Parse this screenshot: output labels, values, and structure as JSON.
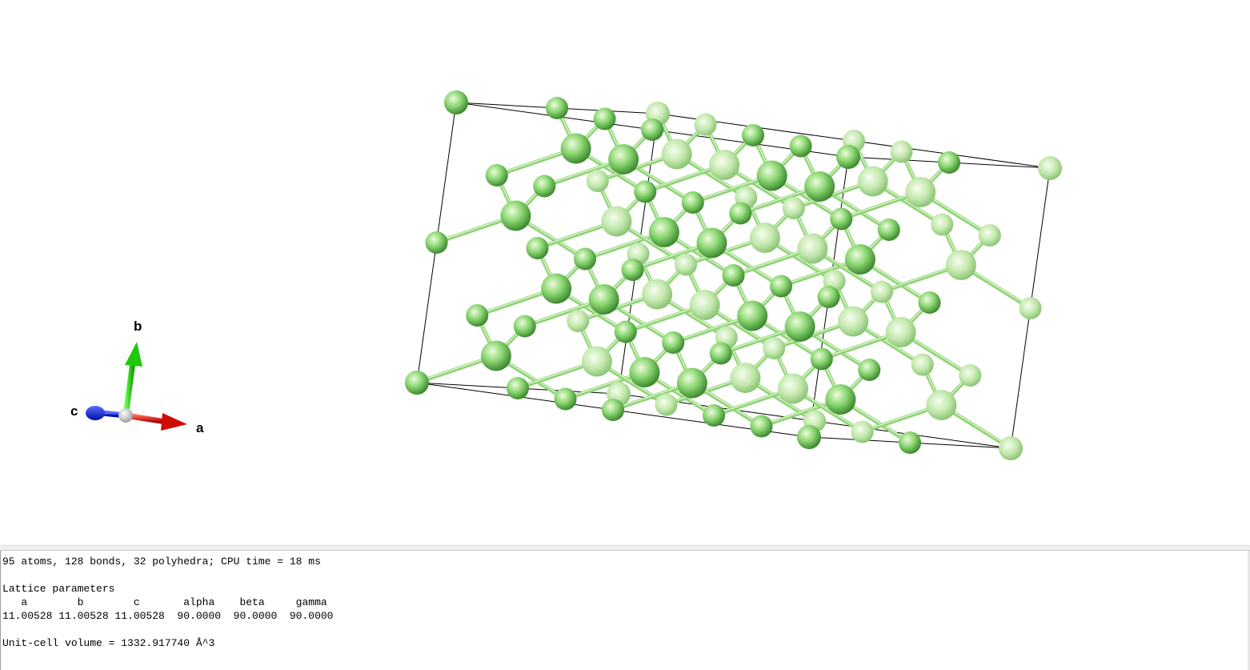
{
  "axes": {
    "a_label": "a",
    "b_label": "b",
    "c_label": "c"
  },
  "structure": {
    "atom_color_bright": "#e8f7d4",
    "atom_color_mid": "#84d06a",
    "atom_color_dark": "#2f7d24",
    "bond_color": "#8fd476",
    "cell_edge_color": "#000000"
  },
  "output": {
    "lines": [
      "95 atoms, 128 bonds, 32 polyhedra; CPU time = 18 ms",
      "",
      "Lattice parameters",
      "   a        b        c       alpha    beta     gamma",
      "11.00528 11.00528 11.00528  90.0000  90.0000  90.0000",
      "",
      "Unit-cell volume = 1332.917740 Å^3"
    ]
  }
}
